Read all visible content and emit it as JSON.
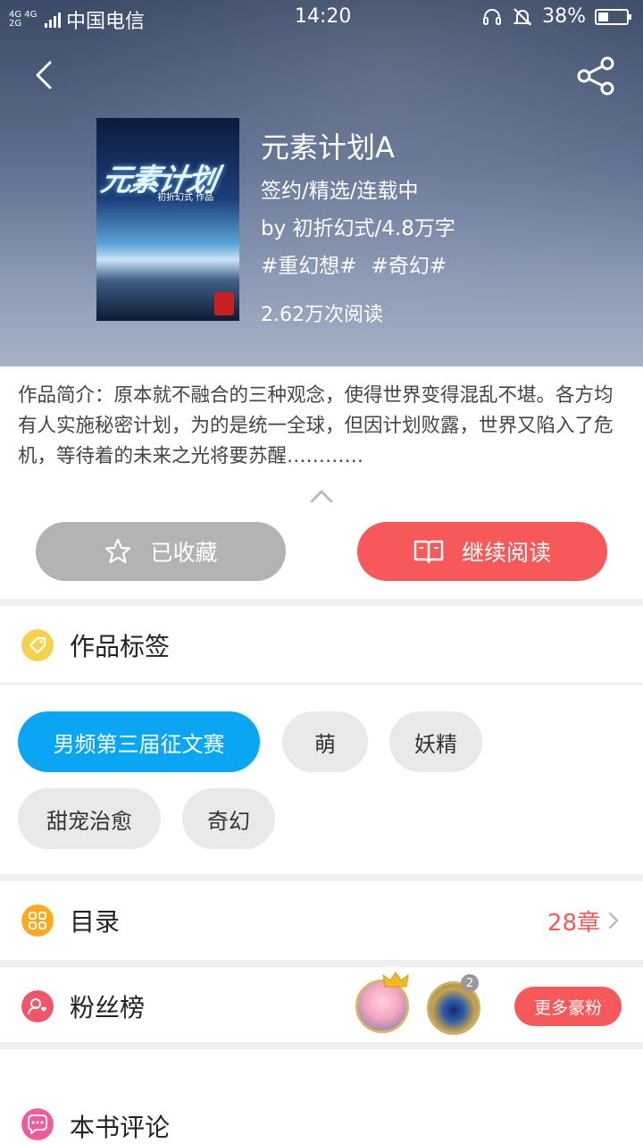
{
  "status_bar": {
    "signal_label_top": "4G 4G",
    "signal_label_bottom": "2G",
    "carrier": "中国电信",
    "time": "14:20",
    "battery": "38%",
    "battery_level": 0.38
  },
  "book": {
    "cover_title": "元素计划",
    "cover_author_tag": "初折幻式 作品",
    "title": "元素计划A",
    "status": "签约/精选/连载中",
    "byline": "by  初折幻式/4.8万字",
    "hash_tags": [
      "#重幻想#",
      "#奇幻#"
    ],
    "reads": "2.62万次阅读",
    "intro": "作品简介：原本就不融合的三种观念，使得世界变得混乱不堪。各方均有人实施秘密计划，为的是统一全球，但因计划败露，世界又陷入了危机，等待着的未来之光将要苏醒…………"
  },
  "actions": {
    "favorited_label": "已收藏",
    "continue_label": "继续阅读"
  },
  "tags_section": {
    "title": "作品标签",
    "chips": [
      "男频第三届征文赛",
      "萌",
      "妖精",
      "甜宠治愈",
      "奇幻"
    ]
  },
  "toc_section": {
    "title": "目录",
    "chapters": "28章"
  },
  "fans_section": {
    "title": "粉丝榜",
    "second_rank": "2",
    "more_label": "更多豪粉"
  },
  "comments_section": {
    "title": "本书评论"
  },
  "colors": {
    "accent_red": "#f7595a",
    "accent_blue": "#0aa6f4",
    "favorite_gray": "#b3b3b3"
  }
}
